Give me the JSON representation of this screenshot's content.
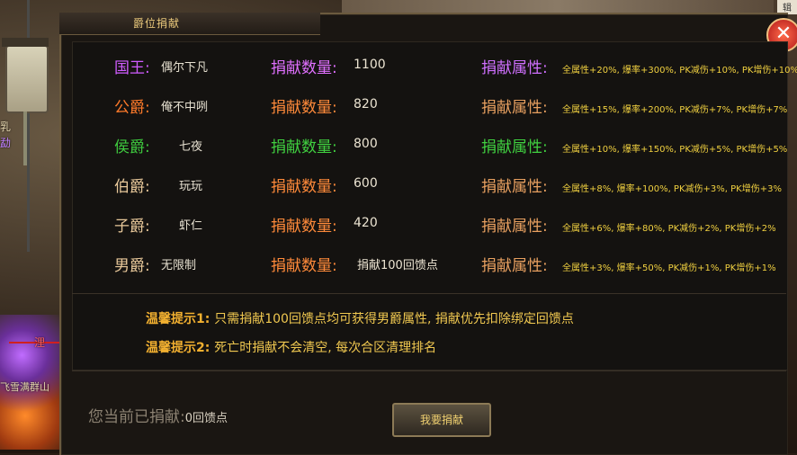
{
  "panel": {
    "title": "爵位捐献"
  },
  "labels": {
    "count_label": "捐献数量:",
    "attr_label": "捐献属性:"
  },
  "ranks": [
    {
      "rank": "国王:",
      "name": "偶尔下凡",
      "count": "1100",
      "attr": "全属性+20%, 爆率+300%, PK减伤+10%, PK增伤+10%",
      "color": "#d05cff"
    },
    {
      "rank": "公爵:",
      "name": "俺不中咧",
      "count": "820",
      "attr": "全属性+15%, 爆率+200%, PK减伤+7%, PK增伤+7%",
      "color": "#ff7a2a"
    },
    {
      "rank": "侯爵:",
      "name": "七夜",
      "count": "800",
      "attr": "全属性+10%, 爆率+150%, PK减伤+5%, PK增伤+5%",
      "color": "#3ec83e"
    },
    {
      "rank": "伯爵:",
      "name": "玩玩",
      "count": "600",
      "attr": "全属性+8%, 爆率+100%, PK减伤+3%, PK增伤+3%",
      "color": "#e8c89a"
    },
    {
      "rank": "子爵:",
      "name": "虾仁",
      "count": "420",
      "attr": "全属性+6%, 爆率+80%, PK减伤+2%, PK增伤+2%",
      "color": "#e8c89a"
    },
    {
      "rank": "男爵:",
      "name": "无限制",
      "count": "捐献100回馈点",
      "attr": "全属性+3%, 爆率+50%, PK减伤+1%, PK增伤+1%",
      "color": "#e8c89a"
    }
  ],
  "tips": [
    {
      "label": "温馨提示1:",
      "text": "只需捐献100回馈点均可获得男爵属性, 捐献优先扣除绑定回馈点"
    },
    {
      "label": "温馨提示2:",
      "text": "死亡时捐献不会清空, 每次合区清理排名"
    }
  ],
  "footer": {
    "donated_label": "您当前已捐献:",
    "donated_value": "0回馈点",
    "donate_button": "我要捐献"
  },
  "side": {
    "text1": "乳",
    "text2": "勐",
    "player_name": "飞雪满群山",
    "player_tag": "浬"
  },
  "corner": {
    "tag": "辑"
  },
  "colors": {
    "accent": "#f2c23a",
    "count_label": "#ff8a3a",
    "attr_label_gold": "#e8a060"
  }
}
